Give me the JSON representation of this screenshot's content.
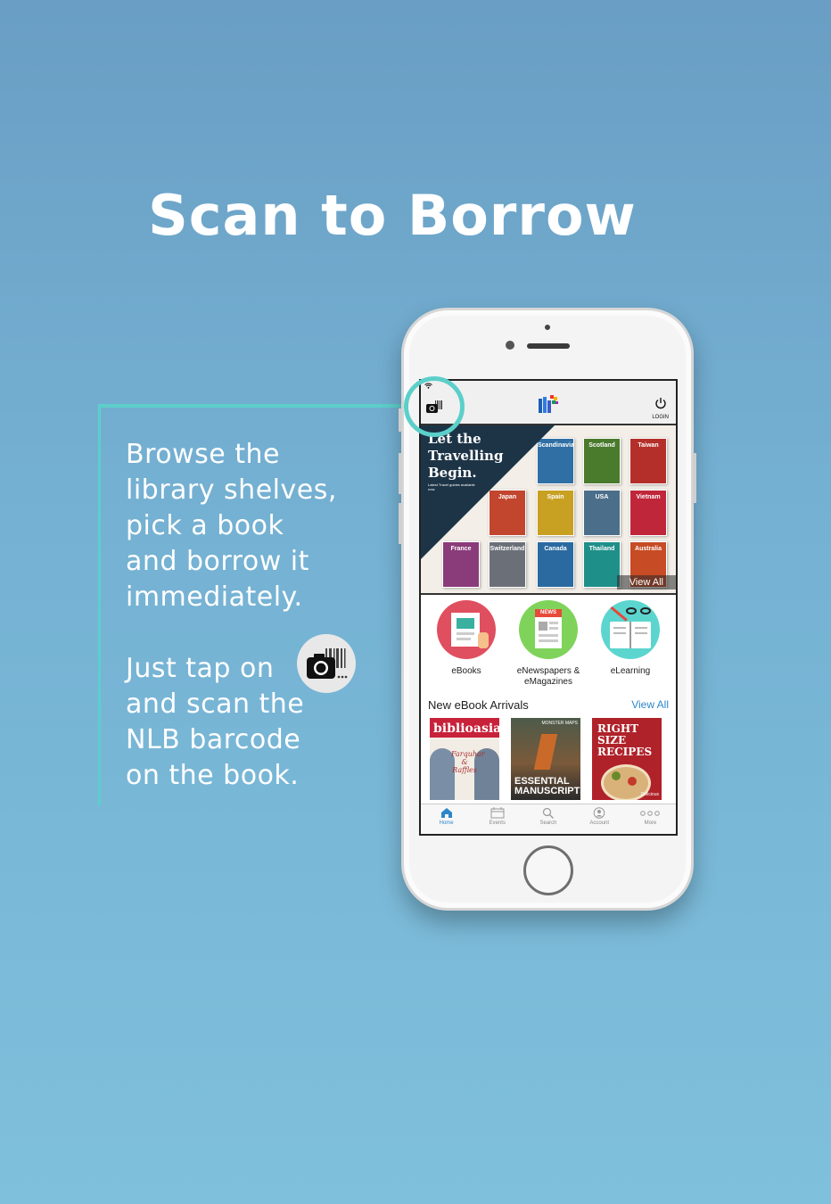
{
  "headline": "Scan to Borrow",
  "description": {
    "paragraph1": "Browse the\nlibrary shelves,\npick a book\nand borrow it\nimmediately.",
    "paragraph2": "Just tap on\nand scan the\nNLB barcode\non the book."
  },
  "colors": {
    "accent": "#5ccfca",
    "link": "#2d86c8",
    "banner_dark": "#1d3447"
  },
  "app": {
    "topbar": {
      "scan_icon": "camera-barcode-icon",
      "logo": "nlb-logo",
      "login_label": "LOGIN"
    },
    "banner": {
      "title": "Let the Travelling Begin.",
      "subtitle": "Latest Travel guides available now.",
      "guides": [
        "Scandinavia",
        "Scotland",
        "Taiwan",
        "Japan",
        "Spain",
        "USA",
        "Vietnam",
        "France",
        "Switzerland",
        "Canada",
        "Thailand",
        "Australia"
      ],
      "view_all": "View All"
    },
    "categories": [
      {
        "label": "eBooks"
      },
      {
        "label": "eNewspapers & eMagazines",
        "badge": "NEWS"
      },
      {
        "label": "eLearning"
      }
    ],
    "new_arrivals": {
      "heading": "New eBook Arrivals",
      "view_all": "View All",
      "covers": [
        {
          "title": "biblioasia",
          "subtitle": "Farquhar & Raffles"
        },
        {
          "title": "ESSENTIAL MANUSCRIPTS",
          "subtitle": "MONSTER MAPS"
        },
        {
          "title": "RIGHT SIZE RECIPES",
          "subtitle": "Delicious"
        }
      ]
    },
    "tabs": [
      {
        "label": "Home",
        "active": true
      },
      {
        "label": "Events"
      },
      {
        "label": "Search"
      },
      {
        "label": "Account"
      },
      {
        "label": "More"
      }
    ]
  }
}
